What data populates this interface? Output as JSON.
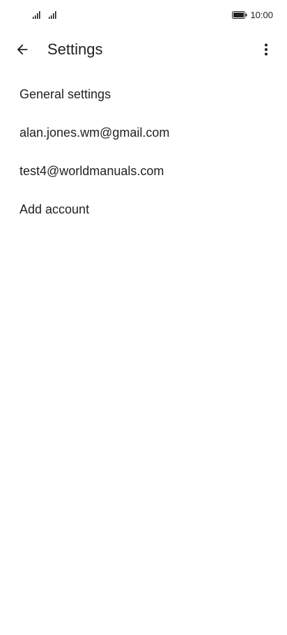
{
  "status_bar": {
    "time": "10:00",
    "icons": [
      "signal-icon",
      "signal-icon",
      "battery-icon"
    ]
  },
  "app_bar": {
    "title": "Settings",
    "back_icon": "arrow-back-icon",
    "more_icon": "more-vert-icon"
  },
  "settings_list": {
    "items": [
      {
        "label": "General settings"
      },
      {
        "label": "alan.jones.wm@gmail.com"
      },
      {
        "label": "test4@worldmanuals.com"
      },
      {
        "label": "Add account"
      }
    ]
  }
}
